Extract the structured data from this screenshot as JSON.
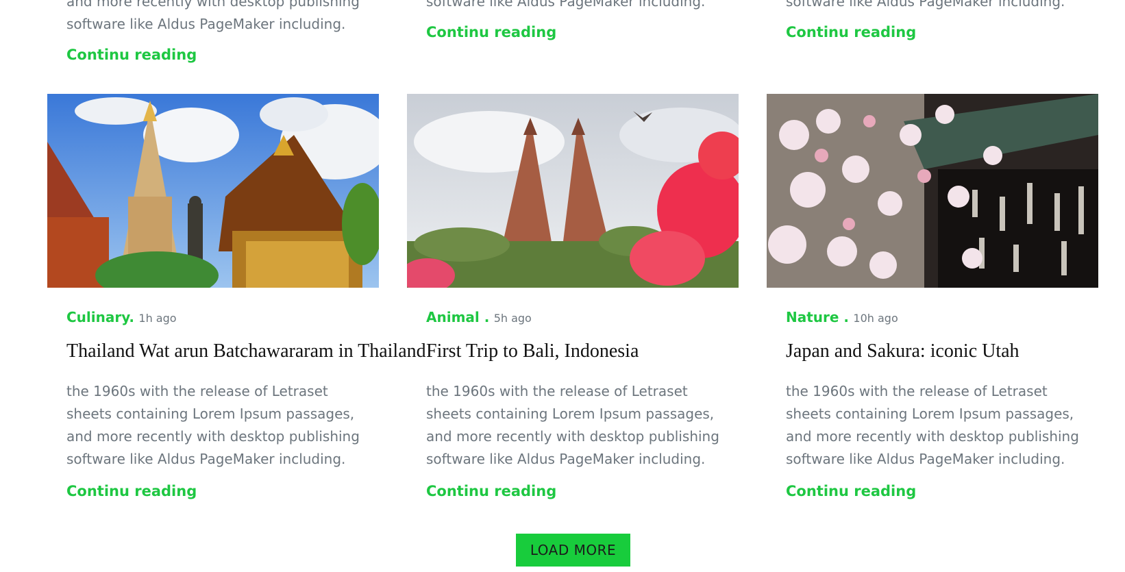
{
  "previous_row": [
    {
      "excerpt_lines": [
        "and more recently with desktop publishing",
        "software like Aldus PageMaker including."
      ],
      "link_label": "Continu reading"
    },
    {
      "excerpt_lines": [
        "software like Aldus PageMaker including."
      ],
      "link_label": "Continu reading"
    },
    {
      "excerpt_lines": [
        "software like Aldus PageMaker including."
      ],
      "link_label": "Continu reading"
    }
  ],
  "posts": [
    {
      "category": "Culinary.",
      "time": "1h ago",
      "title": "Thailand Wat arun Batchawararam in Thailand",
      "excerpt": "the 1960s with the release of Letraset sheets containing Lorem Ipsum passages, and more recently with desktop publishing software like Aldus PageMaker including.",
      "link_label": "Continu reading",
      "image": "thai-temple-photo"
    },
    {
      "category": "Animal .",
      "time": "5h ago",
      "title": "First Trip to Bali, Indonesia",
      "excerpt": "the 1960s with the release of Letraset sheets containing Lorem Ipsum passages, and more recently with desktop publishing software like Aldus PageMaker including.",
      "link_label": "Continu reading",
      "image": "bali-gate-photo"
    },
    {
      "category": "Nature .",
      "time": "10h ago",
      "title": "Japan and Sakura: iconic Utah",
      "excerpt": "the 1960s with the release of Letraset sheets containing Lorem Ipsum passages, and more recently with desktop publishing software like Aldus PageMaker including.",
      "link_label": "Continu reading",
      "image": "sakura-photo"
    }
  ],
  "load_more_label": "LOAD MORE",
  "colors": {
    "accent": "#1ec742",
    "button": "#18cc3c",
    "muted": "#6c757d"
  }
}
